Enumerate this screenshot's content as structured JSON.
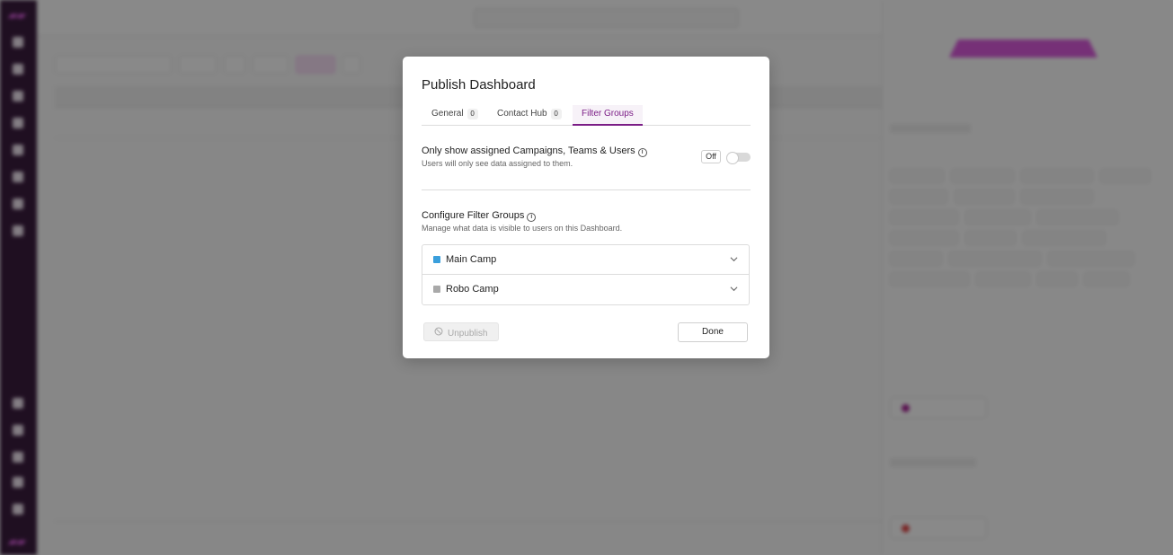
{
  "modal": {
    "title": "Publish Dashboard",
    "tabs": [
      {
        "label": "General",
        "count": "0"
      },
      {
        "label": "Contact Hub",
        "count": "0"
      },
      {
        "label": "Filter Groups"
      }
    ],
    "active_tab": "Filter Groups",
    "assigned_section": {
      "title": "Only show assigned Campaigns, Teams & Users",
      "subtitle": "Users will only see data assigned to them.",
      "toggle_state": "Off",
      "enabled": false
    },
    "filter_groups_section": {
      "title": "Configure Filter Groups",
      "subtitle": "Manage what data is visible to users on this Dashboard.",
      "groups": [
        {
          "label": "Main Camp",
          "color": "#3a9fdc"
        },
        {
          "label": "Robo Camp",
          "color": "#a9a9a9"
        }
      ]
    },
    "unpublish_label": "Unpublish",
    "done_label": "Done"
  },
  "colors": {
    "accent": "#7b1d86",
    "sidebar": "#2b0a2f",
    "overlay": "rgba(20,20,20,0.5)"
  }
}
